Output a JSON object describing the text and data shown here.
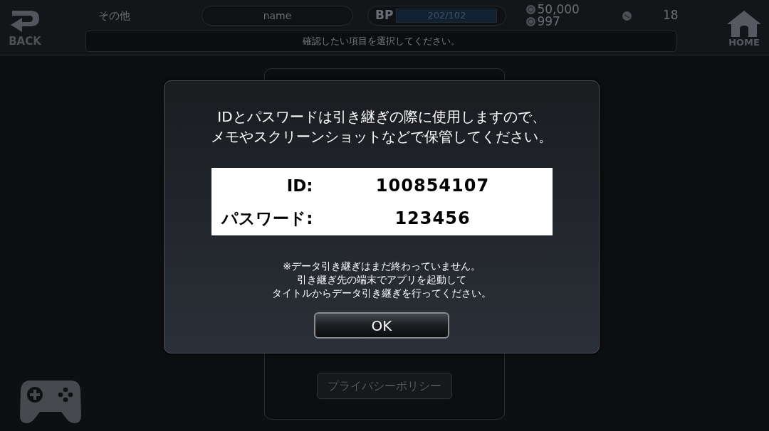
{
  "header": {
    "back_label": "BACK",
    "section_title": "その他",
    "player_name": "name",
    "bp": {
      "label": "BP",
      "reading": "202/102"
    },
    "currencies": [
      {
        "amount": "50,000"
      },
      {
        "amount": "997"
      }
    ],
    "item_count": "18",
    "home_label": "HOME",
    "instruction": "確認したい項目を選択してください。"
  },
  "background_panel": {
    "buttons": [
      "プライバシーポリシー"
    ]
  },
  "dialog": {
    "message_lines": [
      "IDとパスワードは引き継ぎの際に使用しますので、",
      "メモやスクリーンショットなどで保管してください。"
    ],
    "credentials": [
      {
        "label": "ID:",
        "value": "100854107"
      },
      {
        "label": "パスワード:",
        "value": "123456"
      }
    ],
    "note_lines": [
      "※データ引き継ぎはまだ終わっていません。",
      "引き継ぎ先の端末でアプリを起動して",
      "タイトルからデータ引き継ぎを行ってください。"
    ],
    "button": "OK"
  }
}
